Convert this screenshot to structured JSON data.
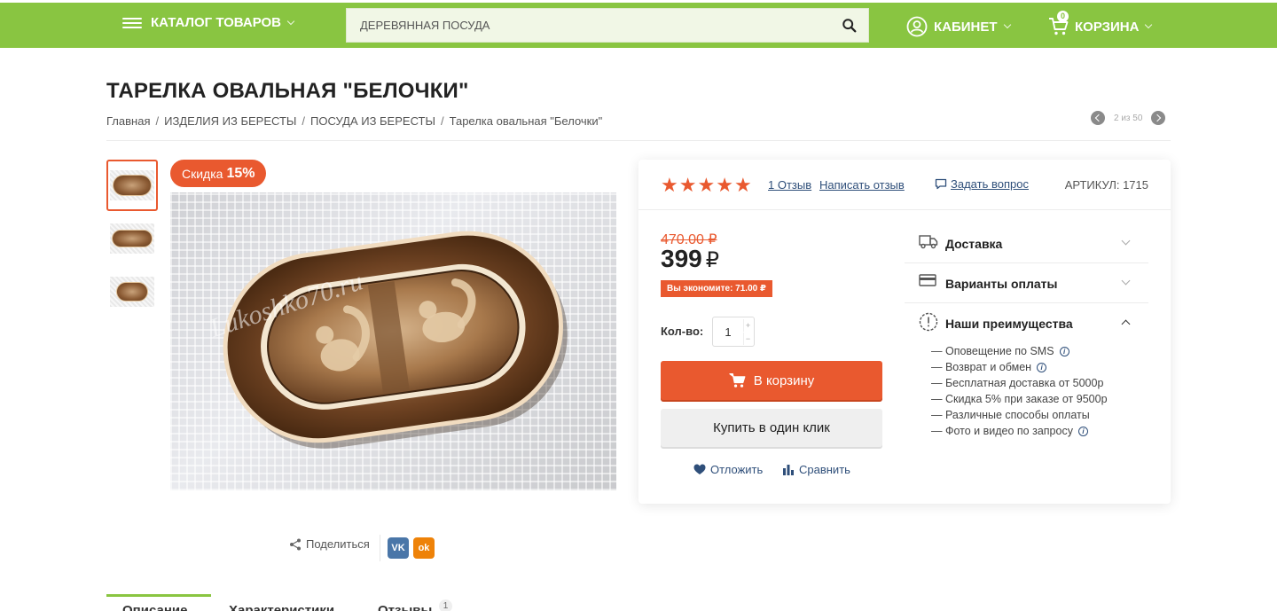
{
  "header": {
    "catalog_label": "КАТАЛОГ ТОВАРОВ",
    "search_value": "ДЕРЕВЯННАЯ ПОСУДА",
    "cabinet_label": "КАБИНЕТ",
    "cart_label": "КОРЗИНА",
    "cart_count": "0"
  },
  "product": {
    "title": "ТАРЕЛКА ОВАЛЬНАЯ \"БЕЛОЧКИ\"",
    "discount_label": "Скидка",
    "discount_value": "15%",
    "image_watermark": "Lukoshko70.ru"
  },
  "breadcrumb": [
    {
      "label": "Главная"
    },
    {
      "label": "ИЗДЕЛИЯ ИЗ БЕРЕСТЫ"
    },
    {
      "label": "ПОСУДА ИЗ БЕРЕСТЫ"
    },
    {
      "label": "Тарелка овальная \"Белочки\""
    }
  ],
  "pager": {
    "text": "2 из 50"
  },
  "card": {
    "rating": 5,
    "reviews_link": "1 Отзыв",
    "write_review": "Написать отзыв",
    "ask_question": "Задать вопрос",
    "sku": "АРТИКУЛ: 1715",
    "old_price": "470.00 ₽",
    "price": "399",
    "currency": "₽",
    "savings": "Вы экономите: 71.00 ₽",
    "qty_label": "Кол-во:",
    "qty_value": "1",
    "add_to_cart": "В корзину",
    "one_click": "Купить в один клик",
    "postpone": "Отложить",
    "compare": "Сравнить"
  },
  "accordion": {
    "delivery": "Доставка",
    "payment": "Варианты оплаты",
    "advantages": "Наши преимущества",
    "advantages_items": [
      {
        "text": "— Оповещение по SMS",
        "info": true
      },
      {
        "text": "— Возврат и обмен",
        "info": true
      },
      {
        "text": "— Бесплатная доставка от 5000р",
        "info": false
      },
      {
        "text": "— Скидка 5% при заказе от 9500р",
        "info": false
      },
      {
        "text": "— Различные способы оплаты",
        "info": false
      },
      {
        "text": "— Фото и видео по запросу",
        "info": true
      }
    ]
  },
  "share": {
    "label": "Поделиться",
    "vk": "VK",
    "ok": "ok"
  },
  "tabs": [
    {
      "label": "Описание"
    },
    {
      "label": "Характеристики"
    },
    {
      "label": "Отзывы",
      "badge": "1"
    }
  ],
  "colors": {
    "brand_green": "#89c541",
    "accent_orange": "#e9592f",
    "link_blue": "#2f4f7a"
  }
}
